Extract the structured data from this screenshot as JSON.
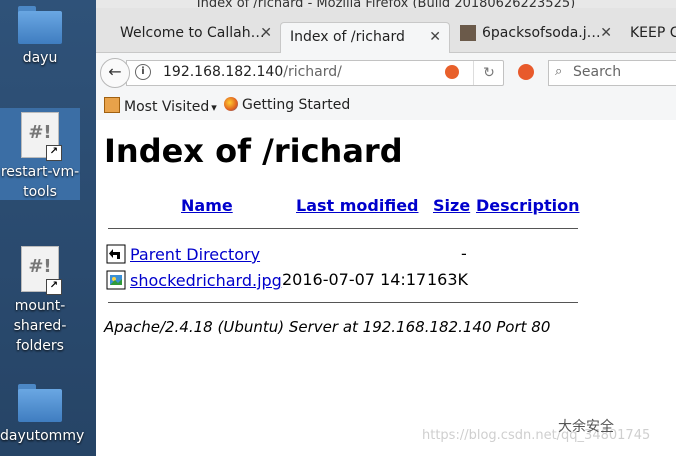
{
  "desktop": {
    "icons": [
      {
        "label": "dayu"
      },
      {
        "label": "restart-vm-tools",
        "lines": [
          "restart-vm-",
          "tools"
        ]
      },
      {
        "label": "mount-shared-folders",
        "lines": [
          "mount-",
          "shared-",
          "folders"
        ]
      },
      {
        "label": "dayutommy",
        "lines": [
          "dayutommy"
        ]
      }
    ]
  },
  "window": {
    "title": "Index of /richard - Mozilla Firefox (Build 20180626223525)"
  },
  "tabs": [
    {
      "label": "Welcome to Callah…",
      "active": false
    },
    {
      "label": "Index of /richard",
      "active": true
    },
    {
      "label": "6packsofsoda.j…",
      "active": false
    },
    {
      "label": "KEEP C",
      "active": false
    }
  ],
  "navbar": {
    "url_host": "192.168.182.140",
    "url_path": "/richard/",
    "search_placeholder": "Search"
  },
  "bookmarks": [
    {
      "label": "Most Visited",
      "has_dropdown": true
    },
    {
      "label": "Getting Started"
    }
  ],
  "page": {
    "heading": "Index of /richard",
    "columns": {
      "name": "Name",
      "modified": "Last modified",
      "size": "Size",
      "description": "Description"
    },
    "rows": [
      {
        "name": "Parent Directory",
        "modified": "",
        "size": "-",
        "icon": "back-icon"
      },
      {
        "name": "shockedrichard.jpg",
        "modified": "2016-07-07 14:17",
        "size": "163K",
        "icon": "image-file-icon"
      }
    ],
    "address": "Apache/2.4.18 (Ubuntu) Server at 192.168.182.140 Port 80"
  },
  "watermark": {
    "text": "https://blog.csdn.net/qq_34801745",
    "logo": "大余安全"
  }
}
